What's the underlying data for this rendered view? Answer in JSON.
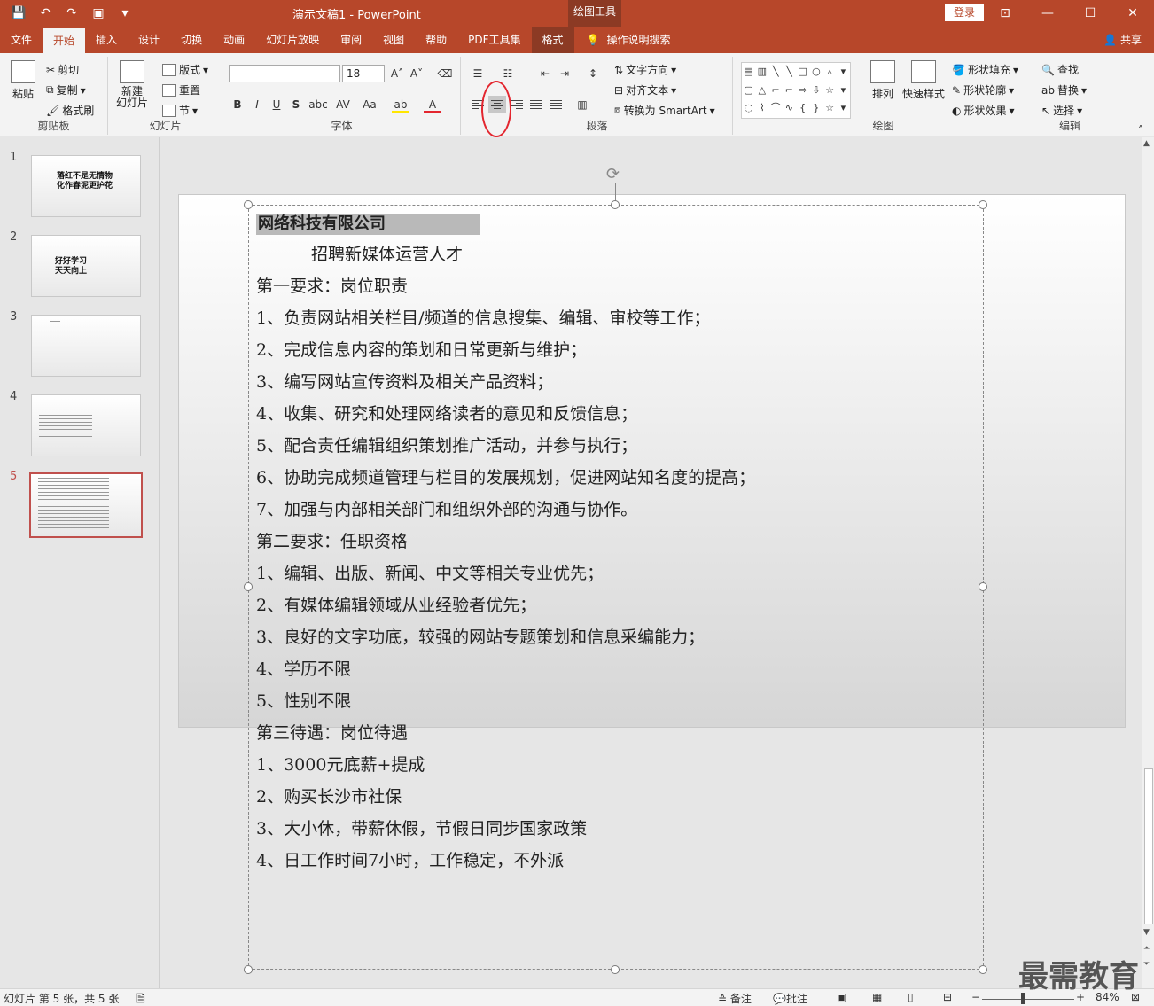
{
  "titlebar": {
    "title": "演示文稿1  -  PowerPoint",
    "context_tool": "绘图工具",
    "login": "登录",
    "qat_icons": [
      "save-icon",
      "undo-icon",
      "redo-icon",
      "slideshow-from-start-icon",
      "customize-qat-icon"
    ]
  },
  "tabs": [
    "文件",
    "开始",
    "插入",
    "设计",
    "切换",
    "动画",
    "幻灯片放映",
    "审阅",
    "视图",
    "帮助",
    "PDF工具集",
    "格式"
  ],
  "active_tab": "开始",
  "tell_me": "操作说明搜索",
  "share": "共享",
  "ribbon": {
    "clipboard": {
      "paste": "粘贴",
      "cut": "剪切",
      "copy": "复制",
      "format_painter": "格式刷",
      "label": "剪贴板"
    },
    "slides": {
      "new_slide": "新建\n幻灯片",
      "layout": "版式",
      "reset": "重置",
      "section": "节",
      "label": "幻灯片"
    },
    "font": {
      "font_name": "",
      "font_size": "18",
      "bold": "B",
      "italic": "I",
      "underline": "U",
      "shadow": "S",
      "strike": "abc",
      "spacing": "AV",
      "case": "Aa",
      "label": "字体"
    },
    "paragraph": {
      "text_direction": "文字方向",
      "align_text": "对齐文本",
      "smartart": "转换为 SmartArt",
      "label": "段落"
    },
    "drawing": {
      "arrange": "排列",
      "quick_styles": "快速样式",
      "shape_fill": "形状填充",
      "shape_outline": "形状轮廓",
      "shape_effects": "形状效果",
      "label": "绘图"
    },
    "editing": {
      "find": "查找",
      "replace": "替换",
      "select": "选择",
      "label": "编辑"
    }
  },
  "thumbnails": [
    {
      "num": "1",
      "text": "落红不是无情物\n化作春泥更护花"
    },
    {
      "num": "2",
      "text": "好好学习\n天天向上"
    },
    {
      "num": "3",
      "text": ""
    },
    {
      "num": "4",
      "text": ""
    },
    {
      "num": "5",
      "text": ""
    }
  ],
  "slide": {
    "heading": "网络科技有限公司",
    "subtitle": "招聘新媒体运营人才",
    "lines": [
      "第一要求：岗位职责",
      "1、负责网站相关栏目/频道的信息搜集、编辑、审校等工作；",
      "2、完成信息内容的策划和日常更新与维护；",
      "3、编写网站宣传资料及相关产品资料；",
      "4、收集、研究和处理网络读者的意见和反馈信息；",
      "5、配合责任编辑组织策划推广活动，并参与执行；",
      "6、协助完成频道管理与栏目的发展规划，促进网站知名度的提高；",
      "7、加强与内部相关部门和组织外部的沟通与协作。",
      "第二要求：任职资格",
      "1、编辑、出版、新闻、中文等相关专业优先；",
      "2、有媒体编辑领域从业经验者优先；",
      "3、良好的文字功底，较强的网站专题策划和信息采编能力；",
      "4、学历不限",
      "5、性别不限",
      "第三待遇：岗位待遇",
      "1、3000元底薪+提成",
      "2、购买长沙市社保",
      "3、大小休，带薪休假，节假日同步国家政策",
      "4、日工作时间7小时，工作稳定，不外派"
    ]
  },
  "statusbar": {
    "slide_info": "幻灯片 第 5 张，共 5 张",
    "notes": "备注",
    "comments": "批注",
    "zoom": "84%"
  },
  "watermark": "最需教育",
  "colors": {
    "accent": "#b7472a",
    "annotation": "#e3262f"
  }
}
